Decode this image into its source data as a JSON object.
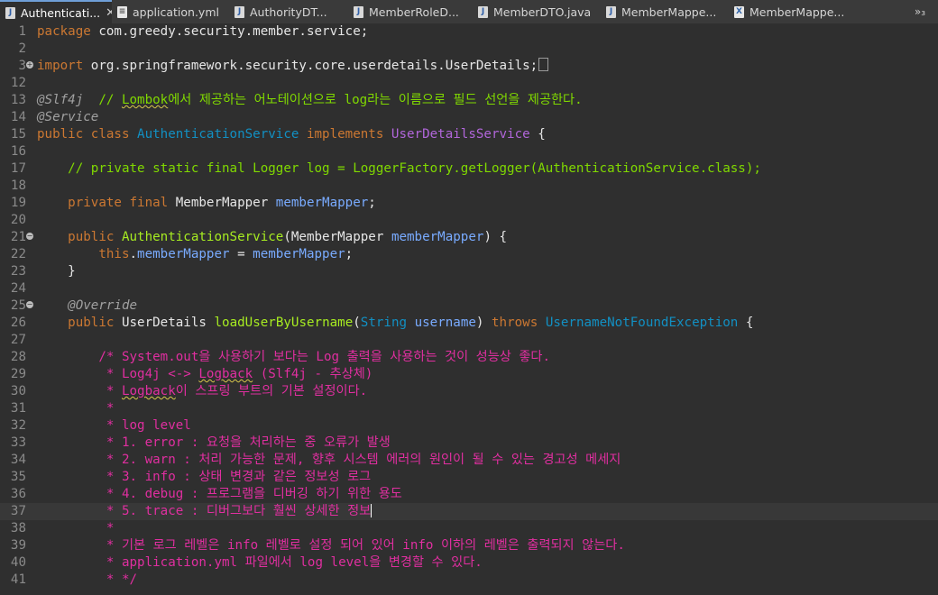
{
  "tabs": [
    {
      "label": "Authenticati...",
      "icon": "java-file-icon",
      "active": true
    },
    {
      "label": "application.yml",
      "icon": "yml-file-icon"
    },
    {
      "label": "AuthorityDT...",
      "icon": "java-file-icon"
    },
    {
      "label": "MemberRoleD...",
      "icon": "java-file-icon"
    },
    {
      "label": "MemberDTO.java",
      "icon": "java-file-icon"
    },
    {
      "label": "MemberMappe...",
      "icon": "java-file-icon"
    },
    {
      "label": "MemberMappe...",
      "icon": "xml-file-icon"
    }
  ],
  "overflow_label": "»₃",
  "colors": {
    "background": "#2f2f2f",
    "comment": "#80d900",
    "block_comment": "#e02fa0",
    "keyword": "#cc7832",
    "type": "#1290c3"
  },
  "lines": [
    {
      "n": "1",
      "t": [
        [
          "kw",
          "package"
        ],
        [
          "plain",
          " com.greedy.security.member.service;"
        ]
      ]
    },
    {
      "n": "2",
      "t": []
    },
    {
      "n": "3",
      "fold": "+",
      "t": [
        [
          "kw",
          "import"
        ],
        [
          "plain",
          " org.springframework.security.core.userdetails.UserDetails;"
        ],
        [
          "box",
          ""
        ]
      ]
    },
    {
      "n": "12",
      "t": []
    },
    {
      "n": "13",
      "t": [
        [
          "ann",
          "@Slf4j"
        ],
        [
          "cmt",
          "  // "
        ],
        [
          "cmt-ul",
          "Lombok"
        ],
        [
          "cmt",
          "에서 제공하는 어노테이션으로 log라는 이름으로 필드 선언을 제공한다."
        ]
      ]
    },
    {
      "n": "14",
      "t": [
        [
          "ann",
          "@Service"
        ]
      ]
    },
    {
      "n": "15",
      "t": [
        [
          "kw",
          "public class "
        ],
        [
          "cls",
          "AuthenticationService"
        ],
        [
          "kw",
          " implements "
        ],
        [
          "iface",
          "UserDetailsService"
        ],
        [
          "plain",
          " {"
        ]
      ]
    },
    {
      "n": "16",
      "t": []
    },
    {
      "n": "17",
      "t": [
        [
          "cmt",
          "    // private static final Logger log = LoggerFactory.getLogger(AuthenticationService.class);"
        ]
      ]
    },
    {
      "n": "18",
      "t": []
    },
    {
      "n": "19",
      "t": [
        [
          "kw",
          "    private final "
        ],
        [
          "var2",
          "MemberMapper"
        ],
        [
          "plain",
          " "
        ],
        [
          "var",
          "memberMapper"
        ],
        [
          "plain",
          ";"
        ]
      ]
    },
    {
      "n": "20",
      "t": []
    },
    {
      "n": "21",
      "fold": "-",
      "t": [
        [
          "kw",
          "    public "
        ],
        [
          "fn",
          "AuthenticationService"
        ],
        [
          "plain",
          "("
        ],
        [
          "var2",
          "MemberMapper"
        ],
        [
          "plain",
          " "
        ],
        [
          "var",
          "memberMapper"
        ],
        [
          "plain",
          ") {"
        ]
      ]
    },
    {
      "n": "22",
      "t": [
        [
          "kw",
          "        this"
        ],
        [
          "plain",
          "."
        ],
        [
          "var",
          "memberMapper"
        ],
        [
          "plain",
          " = "
        ],
        [
          "var",
          "memberMapper"
        ],
        [
          "plain",
          ";"
        ]
      ]
    },
    {
      "n": "23",
      "t": [
        [
          "plain",
          "    }"
        ]
      ]
    },
    {
      "n": "24",
      "t": []
    },
    {
      "n": "25",
      "fold": "-",
      "t": [
        [
          "ann",
          "    @Override"
        ]
      ]
    },
    {
      "n": "26",
      "t": [
        [
          "kw",
          "    public "
        ],
        [
          "var2",
          "UserDetails"
        ],
        [
          "plain",
          " "
        ],
        [
          "fn",
          "loadUserByUsername"
        ],
        [
          "plain",
          "("
        ],
        [
          "cls",
          "String"
        ],
        [
          "plain",
          " "
        ],
        [
          "var",
          "username"
        ],
        [
          "plain",
          ") "
        ],
        [
          "kw",
          "throws"
        ],
        [
          "plain",
          " "
        ],
        [
          "cls",
          "UsernameNotFoundException"
        ],
        [
          "plain",
          " {"
        ]
      ]
    },
    {
      "n": "27",
      "t": []
    },
    {
      "n": "28",
      "t": [
        [
          "blk",
          "        /* System.out을 사용하기 보다는 Log 출력을 사용하는 것이 성능상 좋다."
        ]
      ]
    },
    {
      "n": "29",
      "t": [
        [
          "blk",
          "         * Log4j <-> "
        ],
        [
          "blk-ul",
          "Logback"
        ],
        [
          "blk",
          " (Slf4j - 추상체)"
        ]
      ]
    },
    {
      "n": "30",
      "t": [
        [
          "blk",
          "         * "
        ],
        [
          "blk-ul",
          "Logback"
        ],
        [
          "blk",
          "이 스프링 부트의 기본 설정이다."
        ]
      ]
    },
    {
      "n": "31",
      "t": [
        [
          "blk",
          "         *"
        ]
      ]
    },
    {
      "n": "32",
      "t": [
        [
          "blk",
          "         * log level"
        ]
      ]
    },
    {
      "n": "33",
      "t": [
        [
          "blk",
          "         * 1. error : 요청을 처리하는 중 오류가 발생"
        ]
      ]
    },
    {
      "n": "34",
      "t": [
        [
          "blk",
          "         * 2. warn : 처리 가능한 문제, 향후 시스템 에러의 원인이 될 수 있는 경고성 메세지"
        ]
      ]
    },
    {
      "n": "35",
      "t": [
        [
          "blk",
          "         * 3. info : 상태 변경과 같은 정보성 로그"
        ]
      ]
    },
    {
      "n": "36",
      "t": [
        [
          "blk",
          "         * 4. debug : 프로그램을 디버깅 하기 위한 용도"
        ]
      ]
    },
    {
      "n": "37",
      "cur": true,
      "t": [
        [
          "blk",
          "         * 5. trace : 디버그보다 훨씬 상세한 정보"
        ],
        [
          "cursor",
          ""
        ]
      ]
    },
    {
      "n": "38",
      "t": [
        [
          "blk",
          "         *"
        ]
      ]
    },
    {
      "n": "39",
      "t": [
        [
          "blk",
          "         * 기본 로그 레벨은 info 레벨로 설정 되어 있어 info 이하의 레벨은 출력되지 않는다."
        ]
      ]
    },
    {
      "n": "40",
      "t": [
        [
          "blk",
          "         * application.yml 파일에서 log level을 변경할 수 있다."
        ]
      ]
    },
    {
      "n": "41",
      "t": [
        [
          "blk",
          "         * */"
        ]
      ]
    }
  ]
}
